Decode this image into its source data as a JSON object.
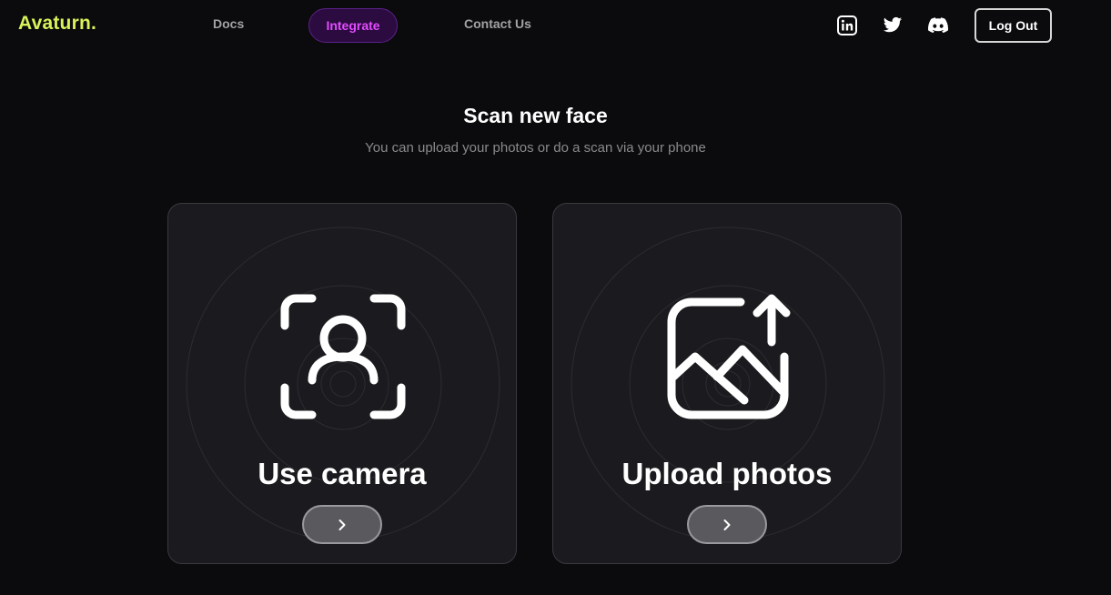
{
  "header": {
    "logo": "Avaturn.",
    "nav": {
      "docs": "Docs",
      "integrate": "Integrate",
      "contact": "Contact Us"
    },
    "social_icons": [
      "linkedin-icon",
      "twitter-icon",
      "discord-icon"
    ],
    "logout_label": "Log Out"
  },
  "main": {
    "title": "Scan new face",
    "subtitle": "You can upload your photos or do a scan via your phone",
    "cards": [
      {
        "label": "Use camera",
        "icon": "face-scan-icon",
        "button_icon": "chevron-right-icon"
      },
      {
        "label": "Upload photos",
        "icon": "image-upload-icon",
        "button_icon": "chevron-right-icon"
      }
    ]
  },
  "colors": {
    "background": "#0b0a0c",
    "logo": "#d7f35a",
    "integrate_text": "#e34cff",
    "integrate_bg": "#2b0b40",
    "card_bg": "#1b1b1f",
    "card_button_bg": "#5a5a5e"
  }
}
